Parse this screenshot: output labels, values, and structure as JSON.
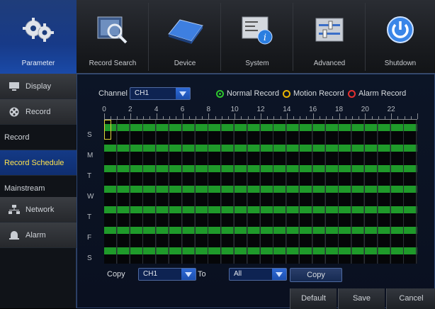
{
  "tabs": [
    {
      "label": "Parameter",
      "icon": "gears-icon",
      "active": true
    },
    {
      "label": "Record Search",
      "icon": "search-icon",
      "active": false
    },
    {
      "label": "Device",
      "icon": "hard-drive-icon",
      "active": false
    },
    {
      "label": "System",
      "icon": "system-info-icon",
      "active": false
    },
    {
      "label": "Advanced",
      "icon": "sliders-icon",
      "active": false
    },
    {
      "label": "Shutdown",
      "icon": "power-icon",
      "active": false
    }
  ],
  "sidebar": {
    "items": [
      {
        "label": "Display",
        "type": "category",
        "icon": "monitor-icon"
      },
      {
        "label": "Record",
        "type": "category",
        "icon": "film-reel-icon"
      },
      {
        "label": "Record",
        "type": "sub"
      },
      {
        "label": "Record Schedule",
        "type": "sub",
        "selected": true
      },
      {
        "label": "Mainstream",
        "type": "sub"
      },
      {
        "label": "Network",
        "type": "category",
        "icon": "network-icon"
      },
      {
        "label": "Alarm",
        "type": "category",
        "icon": "alarm-bell-icon"
      }
    ]
  },
  "schedule": {
    "channel_label": "Channel",
    "channel_value": "CH1",
    "legend": [
      {
        "label": "Normal Record",
        "color": "#2ec72e",
        "selected": true
      },
      {
        "label": "Motion Record",
        "color": "#e8b400",
        "selected": false
      },
      {
        "label": "Alarm Record",
        "color": "#e53030",
        "selected": false
      }
    ],
    "hour_labels": [
      "0",
      "2",
      "4",
      "6",
      "8",
      "10",
      "12",
      "14",
      "16",
      "18",
      "20",
      "22"
    ],
    "days": [
      "S",
      "M",
      "T",
      "W",
      "T",
      "F",
      "S"
    ],
    "normal_record_hours_per_day": 24
  },
  "copy": {
    "copy_label": "Copy",
    "from_value": "CH1",
    "to_label": "To",
    "to_value": "All",
    "copy_button": "Copy"
  },
  "buttons": {
    "default": "Default",
    "save": "Save",
    "cancel": "Cancel"
  },
  "colors": {
    "accent_blue": "#1a4aa8",
    "schedule_green": "#1f9a2a",
    "selected_text": "#ffe34d"
  }
}
